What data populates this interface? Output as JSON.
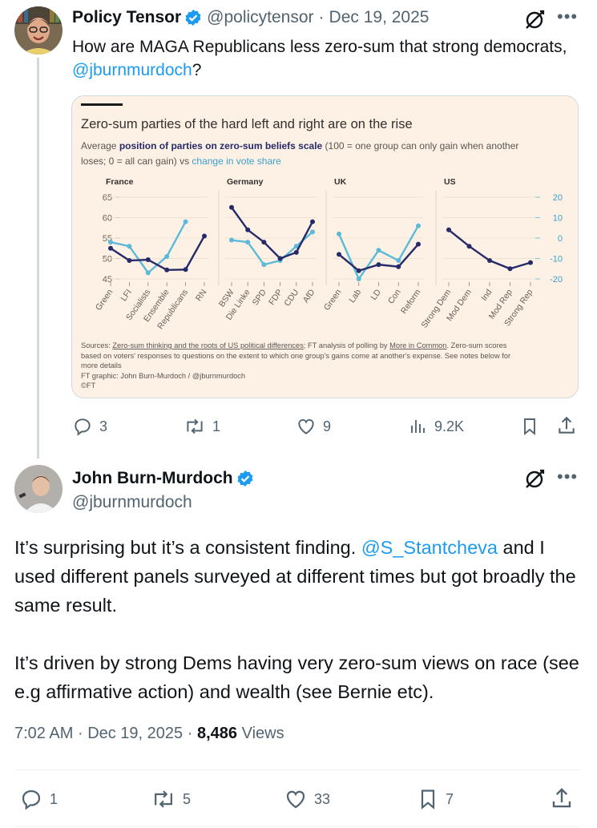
{
  "tweet1": {
    "display_name": "Policy Tensor",
    "handle": "@policytensor",
    "separator": "·",
    "date": "Dec 19, 2025",
    "text_before": "How are MAGA Republicans less zero-sum that strong democrats, ",
    "mention": "@jburnmurdoch",
    "text_after": "?",
    "actions": {
      "replies": "3",
      "reposts": "1",
      "likes": "9",
      "views": "9.2K"
    }
  },
  "chart_card": {
    "title": "Zero-sum parties of the hard left and right are on the rise",
    "subtitle_prefix": "Average ",
    "subtitle_series1": "position of parties on zero-sum beliefs scale",
    "subtitle_mid": " (100 = one group can only gain when another",
    "subtitle_line2_pre": "loses; 0 = all can gain) vs ",
    "subtitle_series2": "change in vote share",
    "sources_label": "Sources: ",
    "sources_link1": "Zero-sum thinking and the roots of US political differences",
    "sources_mid": "; FT analysis of polling by ",
    "sources_link2": "More in Common",
    "sources_rest": ". Zero-sum scores",
    "sources_line2": "based on voters' responses to questions on the extent to which one group's gains come at another's expense. See notes below for",
    "sources_line3": "more details",
    "credit": "FT graphic: John Burn-Murdoch / @jburnmurdoch",
    "copyright": "©FT",
    "colors": {
      "zero_sum": "#262a6a",
      "vote_change": "#5bbad8",
      "background": "#fdf1e5"
    }
  },
  "chart_data": {
    "type": "line",
    "left_axis": {
      "ticks": [
        "65",
        "60",
        "55",
        "50",
        "45"
      ],
      "ylim": [
        45,
        65
      ]
    },
    "right_axis": {
      "ticks": [
        "20",
        "10",
        "0",
        "-10",
        "-20"
      ],
      "ylim": [
        -20,
        20
      ]
    },
    "panels": [
      {
        "name": "France",
        "categories": [
          "Green",
          "LFI",
          "Socialists",
          "Ensemble",
          "Republicans",
          "RN"
        ],
        "series": [
          {
            "values": [
              52.5,
              49.5,
              49.7,
              47.2,
              47.3,
              55.5
            ]
          },
          {
            "values": [
              54.0,
              53.0,
              46.5,
              50.5,
              59.0
            ]
          }
        ]
      },
      {
        "name": "Germany",
        "categories": [
          "BSW",
          "Die Linke",
          "SPD",
          "FDP",
          "CDU",
          "AfD"
        ],
        "series": [
          {
            "values": [
              62.5,
              57.0,
              54.0,
              50.0,
              51.5,
              59.0
            ]
          },
          {
            "values": [
              54.5,
              54.0,
              48.5,
              49.5,
              53.0,
              56.5
            ]
          }
        ]
      },
      {
        "name": "UK",
        "categories": [
          "Green",
          "Lab",
          "LD",
          "Con",
          "Reform"
        ],
        "series": [
          {
            "values": [
              51.0,
              47.0,
              48.5,
              48.0,
              53.5
            ]
          },
          {
            "values": [
              56.0,
              45.0,
              52.0,
              49.5,
              58.0
            ]
          }
        ]
      },
      {
        "name": "US",
        "categories": [
          "Strong Dem",
          "Mod Dem",
          "Ind",
          "Mod Rep",
          "Strong Rep"
        ],
        "series": [
          {
            "values": [
              57.0,
              53.0,
              49.5,
              47.5,
              49.0
            ]
          }
        ]
      }
    ]
  },
  "tweet2": {
    "display_name": "John Burn-Murdoch",
    "handle": "@jburnmurdoch",
    "para1_before": "It’s surprising but it’s a consistent finding. ",
    "mention": "@S_Stantcheva",
    "para1_after": " and I used different panels surveyed at different times but got broadly the same result.",
    "para2": "It’s driven by strong Dems having very zero-sum views on race (see e.g affirmative action) and wealth (see Bernie etc).",
    "time": "7:02 AM",
    "separator": "·",
    "date": "Dec 19, 2025",
    "separator2": "·",
    "views_count": "8,486",
    "views_label": "Views",
    "actions": {
      "replies": "1",
      "reposts": "5",
      "likes": "33",
      "bookmarks": "7"
    }
  },
  "icons": [
    "verified-badge-icon",
    "grok-icon",
    "more-icon",
    "reply-icon",
    "repost-icon",
    "like-icon",
    "views-icon",
    "bookmark-icon",
    "share-icon"
  ]
}
